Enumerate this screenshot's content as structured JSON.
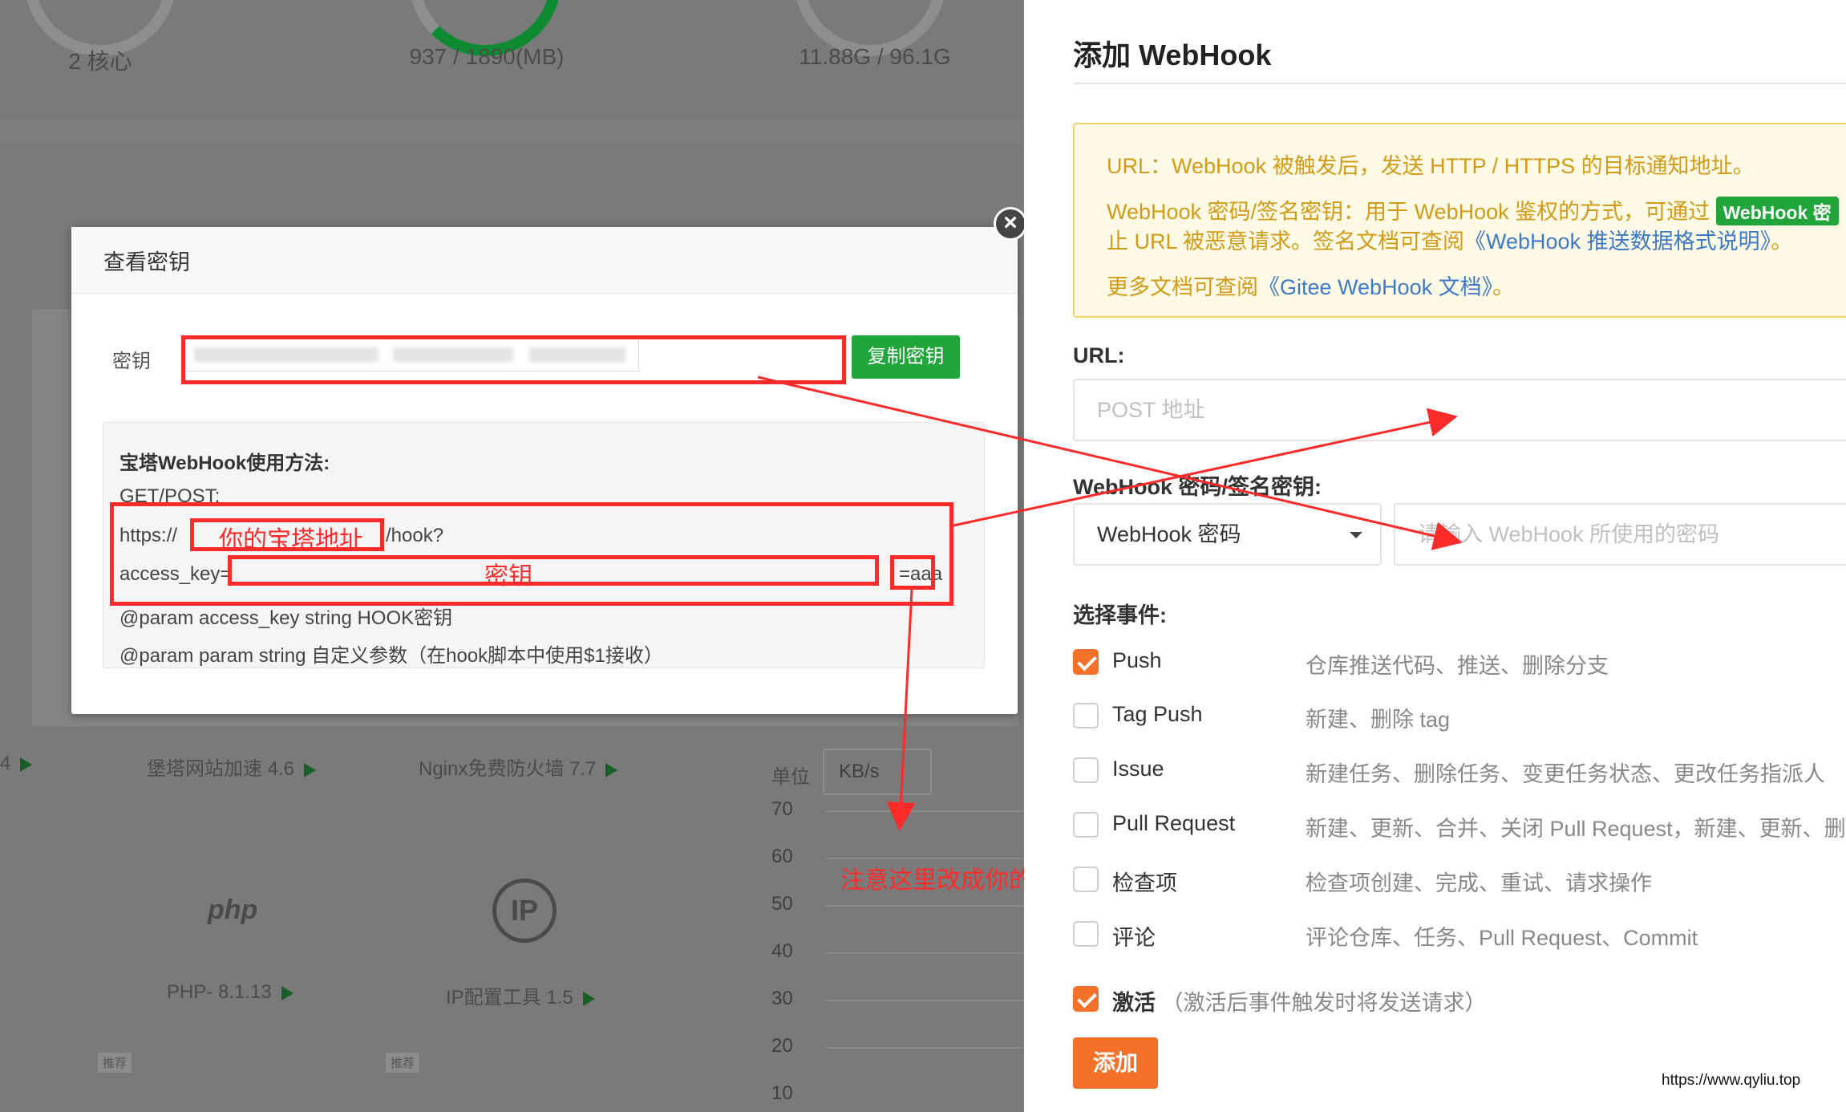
{
  "background": {
    "stats": [
      "2 核心",
      "937 / 1890(MB)",
      "11.88G / 96.1G"
    ],
    "plugins": [
      {
        "label": "4",
        "arrow": true
      },
      {
        "label": "堡塔网站加速 4.6",
        "arrow": true
      },
      {
        "label": "Nginx免费防火墙 7.7",
        "arrow": true
      }
    ],
    "plugins_row2": [
      {
        "label": "PHP- 8.1.13",
        "arrow": true
      },
      {
        "label": "IP配置工具 1.5",
        "arrow": true
      }
    ],
    "php_logo": "php",
    "ip_logo": "IP",
    "recommend_tag": "推荐",
    "unit_label": "单位",
    "unit_value": "KB/s",
    "y_ticks": [
      "70",
      "60",
      "50",
      "40",
      "30",
      "20",
      "10"
    ]
  },
  "modal": {
    "title": "查看密钥",
    "close_icon": "close-icon",
    "key_label": "密钥",
    "copy_button": "复制密钥",
    "usage_title": "宝塔WebHook使用方法:",
    "usage_lines": [
      "GET/POST:",
      "https://",
      "/hook?",
      "access_key=",
      "=aaa",
      "@param access_key string HOOK密钥",
      "@param param string 自定义参数（在hook脚本中使用$1接收）"
    ]
  },
  "annotations": {
    "panel_address": "你的宝塔地址",
    "key": "密钥",
    "note": "注意这里改成你的仓库名称",
    "color": "#ff2a2a"
  },
  "drawer": {
    "title": "添加 WebHook",
    "notice": {
      "line1": "URL：WebHook 被触发后，发送 HTTP / HTTPS 的目标通知地址。",
      "line2_prefix": "WebHook 密码/签名密钥：用于 WebHook 鉴权的方式，可通过",
      "line2_badge": "WebHook 密",
      "line3_prefix": "止 URL 被恶意请求。签名文档可查阅",
      "line3_link": "《WebHook 推送数据格式说明》",
      "line3_suffix": "。",
      "line4_prefix": "更多文档可查阅",
      "line4_link": "《Gitee WebHook 文档》",
      "line4_suffix": "。"
    },
    "url_label": "URL:",
    "url_placeholder": "POST 地址",
    "secret_label": "WebHook 密码/签名密钥:",
    "secret_type": "WebHook 密码",
    "secret_placeholder": "请输入 WebHook 所使用的密码",
    "events_label": "选择事件:",
    "events": [
      {
        "name": "Push",
        "desc": "仓库推送代码、推送、删除分支",
        "checked": true
      },
      {
        "name": "Tag Push",
        "desc": "新建、删除 tag",
        "checked": false
      },
      {
        "name": "Issue",
        "desc": "新建任务、删除任务、变更任务状态、更改任务指派人",
        "checked": false
      },
      {
        "name": "Pull Request",
        "desc": "新建、更新、合并、关闭 Pull Request，新建、更新、删",
        "checked": false
      },
      {
        "name": "检查项",
        "desc": "检查项创建、完成、重试、请求操作",
        "checked": false
      },
      {
        "name": "评论",
        "desc": "评论仓库、任务、Pull Request、Commit",
        "checked": false
      }
    ],
    "activate_label": "激活",
    "activate_desc": "（激活后事件触发时将发送请求）",
    "activate_checked": true,
    "add_button": "添加",
    "accent": "#f5712a",
    "notice_color": "#d19a17"
  },
  "watermark": "https://www.qyliu.top"
}
